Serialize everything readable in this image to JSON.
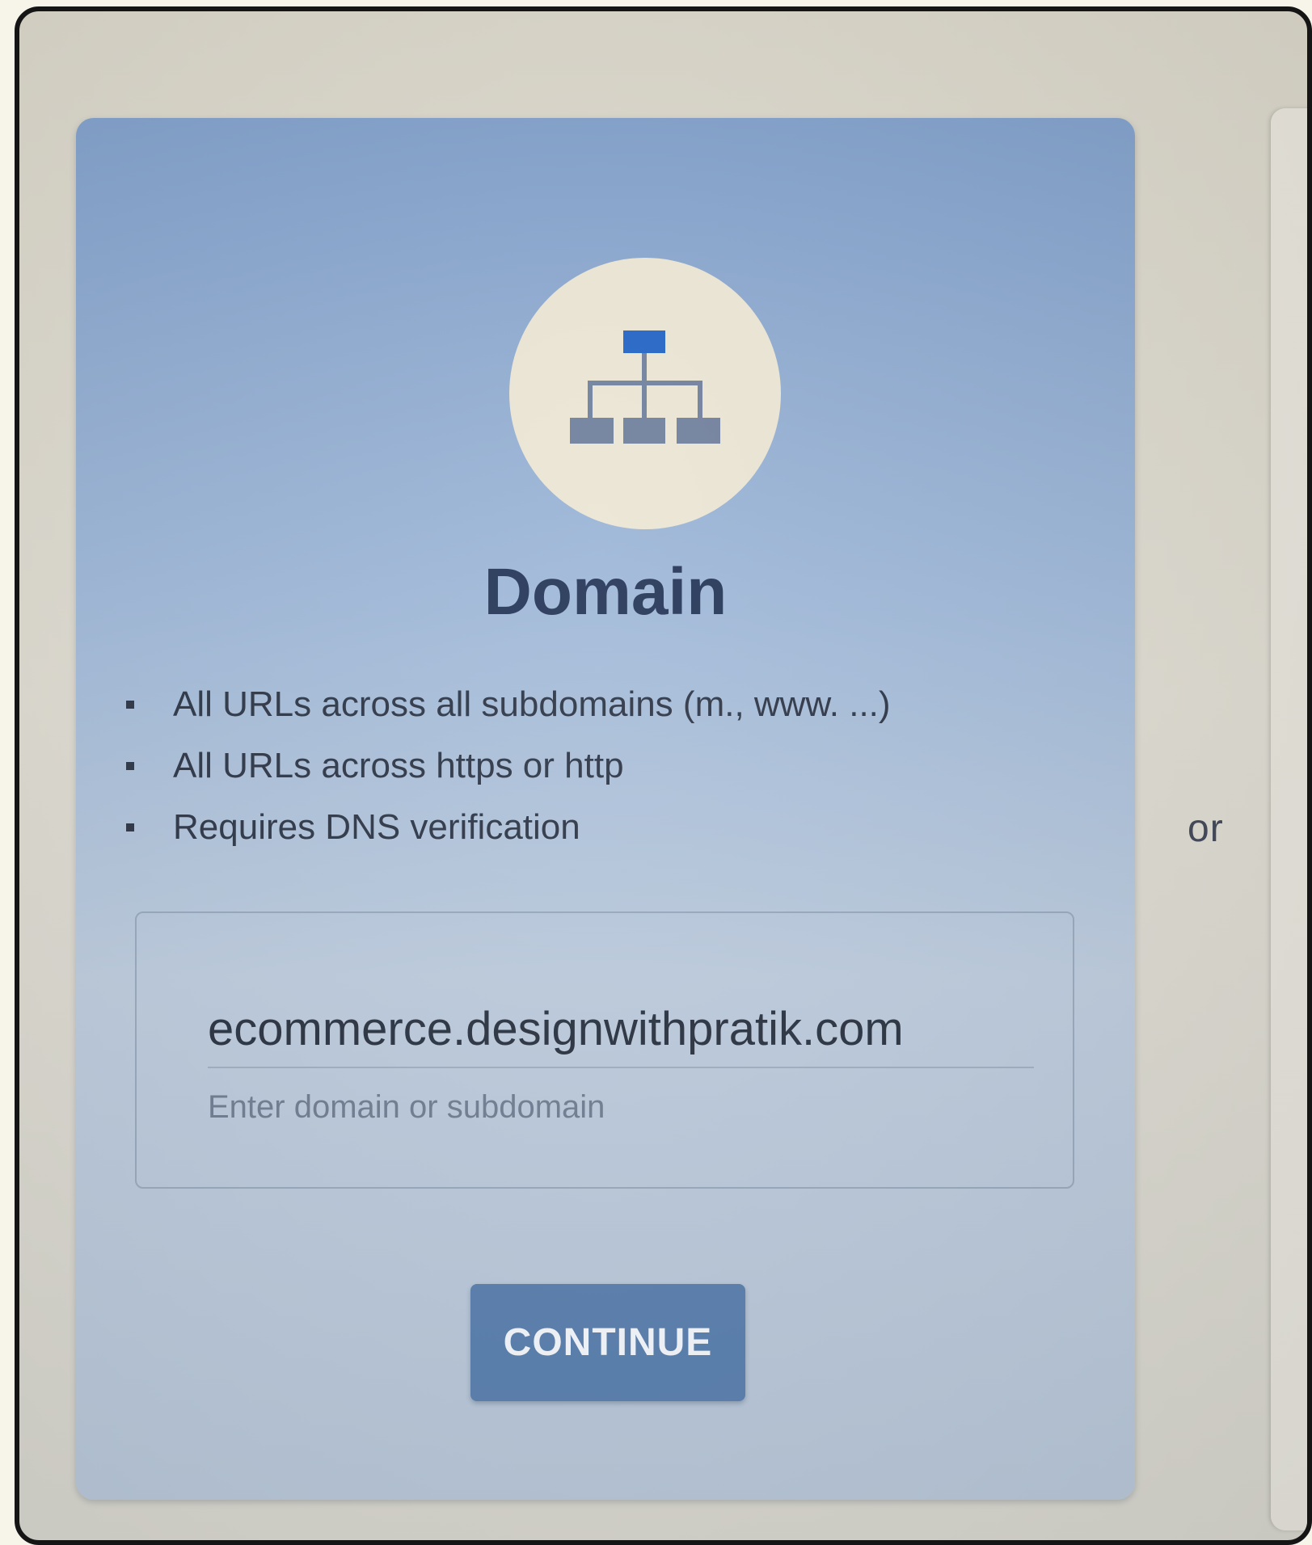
{
  "card": {
    "icon": "sitemap-icon",
    "title": "Domain",
    "features": [
      "All URLs across all subdomains (m., www. ...)",
      "All URLs across https or http",
      "Requires DNS verification"
    ],
    "input": {
      "value": "ecommerce.designwithpratik.com",
      "hint": "Enter domain or subdomain"
    },
    "continue_label": "CONTINUE"
  },
  "separator": {
    "label": "or"
  },
  "colors": {
    "card_background": "#9fb8d8",
    "button_background": "#587ead",
    "title_text": "#233456",
    "icon_accent": "#1f63c6",
    "icon_gray": "#6f7f9c"
  }
}
